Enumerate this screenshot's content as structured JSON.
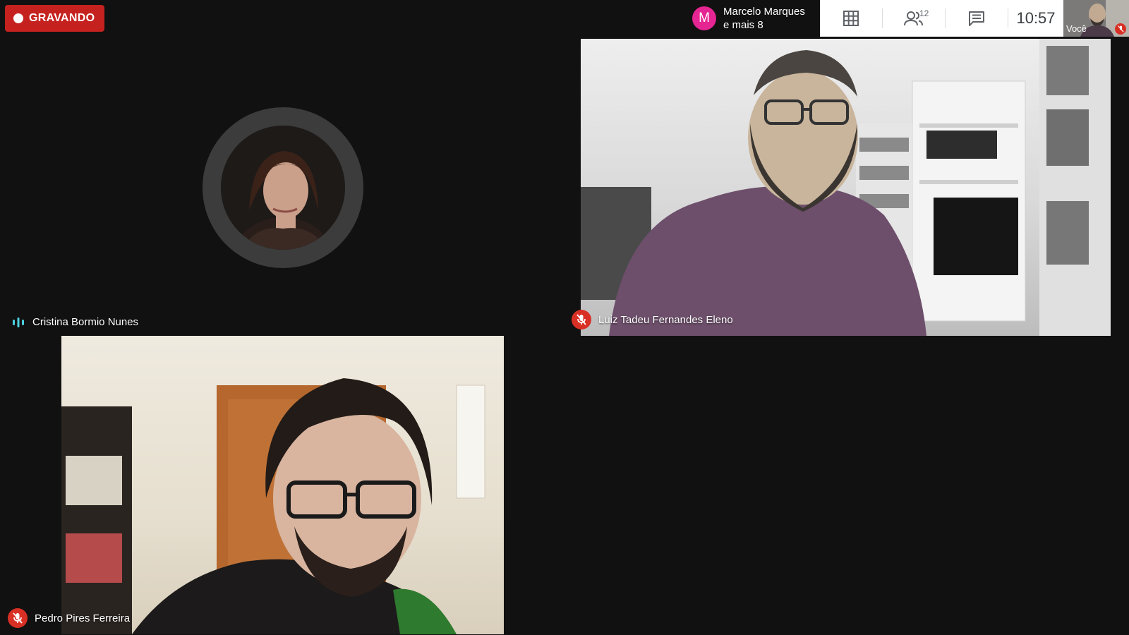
{
  "recording": {
    "label": "GRAVANDO"
  },
  "presenter": {
    "initial": "M",
    "name": "Marcelo Marques",
    "more": "e mais 8"
  },
  "toolbar": {
    "participants_count": "12",
    "clock": "10:57"
  },
  "self_view": {
    "label": "Você"
  },
  "participants": [
    {
      "name": "Cristina Bormio Nunes",
      "state": "speaking"
    },
    {
      "name": "Luiz Tadeu Fernandes Eleno",
      "state": "muted"
    },
    {
      "name": "Pedro Pires Ferreira",
      "state": "muted"
    }
  ],
  "colors": {
    "recording": "#c5221f",
    "muted": "#d93025",
    "avatar_m": "#e52592",
    "speaking": "#4dd0e1"
  },
  "icons": [
    "record-dot-icon",
    "grid-layout-icon",
    "people-icon",
    "chat-icon",
    "mic-off-icon",
    "speaking-indicator-icon"
  ]
}
